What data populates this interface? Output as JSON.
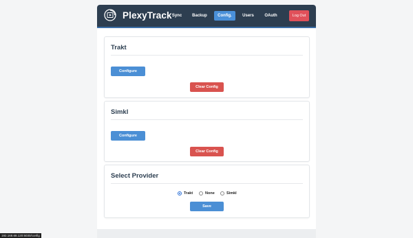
{
  "brand": {
    "name": "PlexyTrack",
    "logo_icon": "film-sync-icon"
  },
  "nav": {
    "items": [
      {
        "label": "Sync",
        "active": false
      },
      {
        "label": "Backup",
        "active": false
      },
      {
        "label": "Config.",
        "active": true
      },
      {
        "label": "Users",
        "active": false
      },
      {
        "label": "OAuth",
        "active": false
      }
    ],
    "logout_label": "Log Out"
  },
  "cards": {
    "trakt": {
      "title": "Trakt",
      "configure_label": "Configure",
      "clear_label": "Clear Config"
    },
    "simkl": {
      "title": "Simkl",
      "configure_label": "Configure",
      "clear_label": "Clear Config"
    },
    "provider": {
      "title": "Select Provider",
      "options": [
        {
          "label": "Trakt",
          "checked": true
        },
        {
          "label": "None",
          "checked": false
        },
        {
          "label": "Simkl",
          "checked": false
        }
      ],
      "save_label": "Save"
    }
  },
  "status_bar": {
    "url": "192.168.68.120:5030/config"
  },
  "colors": {
    "navbar": "#2d3e50",
    "accent_blue": "#4b8fd5",
    "danger_red": "#d9534f",
    "logout_red": "#e0505a"
  }
}
